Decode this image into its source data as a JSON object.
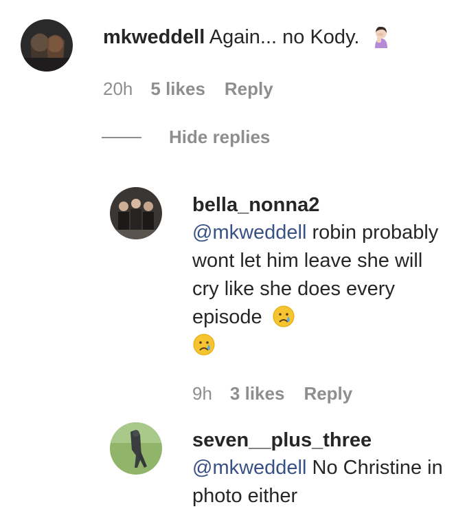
{
  "comment": {
    "username": "mkweddell",
    "text": "Again... no Kody.",
    "emoji": "woman-facepalming-icon",
    "time": "20h",
    "likes": "5 likes",
    "reply": "Reply"
  },
  "hide_replies": "Hide replies",
  "replies": [
    {
      "username": "bella_nonna2",
      "mention": "@mkweddell",
      "text": "robin probably wont let him leave she will cry like she does every episode",
      "emojis": [
        "crying-face-icon",
        "crying-face-icon"
      ],
      "time": "9h",
      "likes": "3 likes",
      "reply": "Reply"
    },
    {
      "username": "seven__plus_three",
      "mention": "@mkweddell",
      "text": "No Christine in photo either"
    }
  ],
  "colors": {
    "text": "#262626",
    "muted": "#8e8e8e",
    "mention": "#385185"
  }
}
